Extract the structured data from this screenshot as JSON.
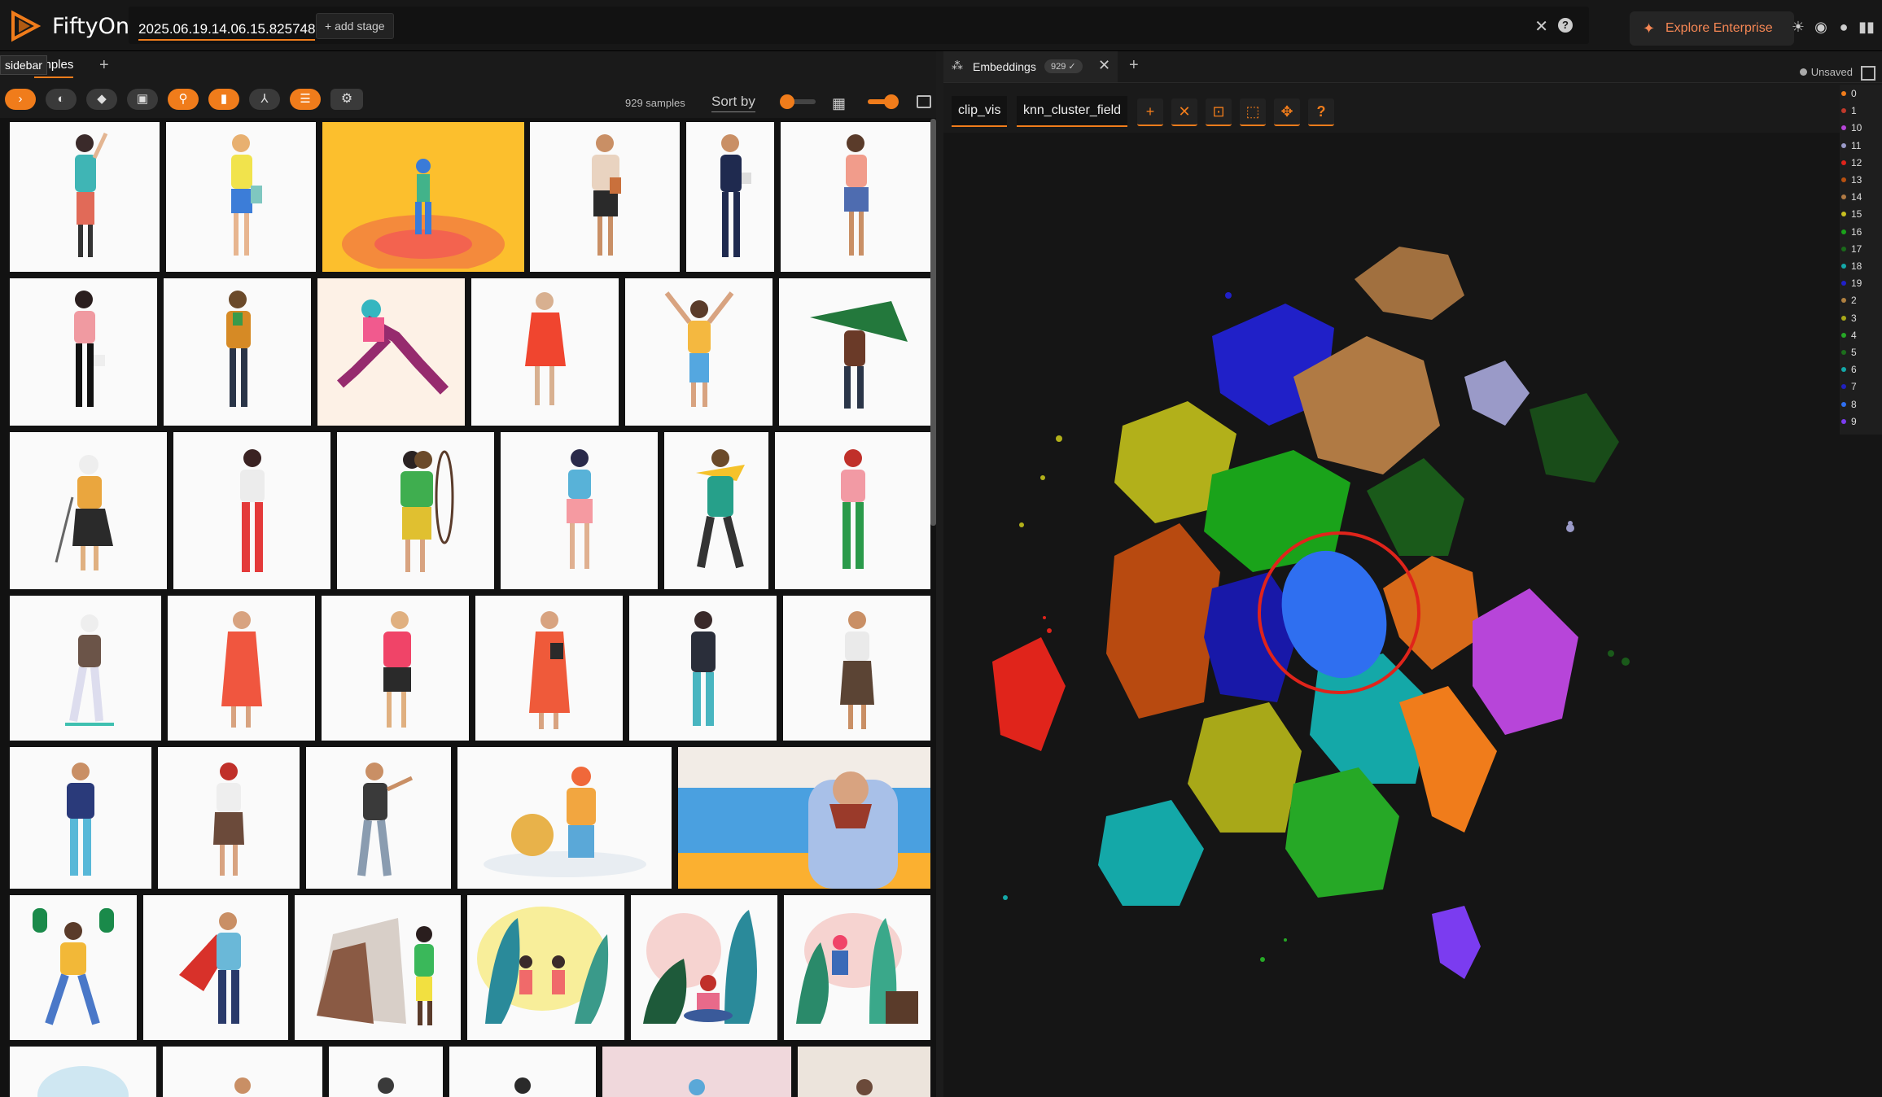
{
  "app": {
    "name": "FiftyOne",
    "dataset": "2025.06.19.14.06.15.825748",
    "add_stage": "+ add stage",
    "explore_enterprise": "Explore Enterprise"
  },
  "left_panel": {
    "tooltip": "sidebar",
    "tab_label": "Samples",
    "tab_visible_text": "amples",
    "sample_count": "929 samples",
    "sort_by": "Sort by"
  },
  "right_panel": {
    "tab_label": "Embeddings",
    "tab_badge": "929 ✓",
    "unsaved": "Unsaved",
    "brain_key": "clip_vis",
    "color_by": "knn_cluster_field"
  },
  "legend": [
    "0",
    "1",
    "10",
    "11",
    "12",
    "13",
    "14",
    "15",
    "16",
    "17",
    "18",
    "19",
    "2",
    "3",
    "4",
    "5",
    "6",
    "7",
    "8",
    "9"
  ],
  "legend_colors": [
    "#f07c1b",
    "#c0392b",
    "#b745d9",
    "#9a9ac8",
    "#e0241b",
    "#b85010",
    "#b07a44",
    "#c8c020",
    "#1aa31a",
    "#1a6a1a",
    "#14a8a8",
    "#2020c8",
    "#b08040",
    "#a8a818",
    "#26a826",
    "#1c6e1c",
    "#14a8a8",
    "#2020c0",
    "#2f6ff0",
    "#7b3cf0"
  ],
  "colors": {
    "accent": "#f07c1b",
    "background": "#121212"
  },
  "icons": [
    "logo-icon",
    "close-icon",
    "help-icon",
    "sparkle-icon",
    "sun-icon",
    "discord-icon",
    "github-icon",
    "book-icon",
    "chevron-right-icon",
    "palette-icon",
    "tag-icon",
    "patch-icon",
    "search-icon",
    "bookmark-icon",
    "merge-icon",
    "list-icon",
    "settings-icon",
    "grid-icon",
    "expand-icon",
    "embeddings-icon",
    "plus-icon",
    "lasso-icon",
    "fit-icon",
    "select-icon",
    "move-icon"
  ]
}
